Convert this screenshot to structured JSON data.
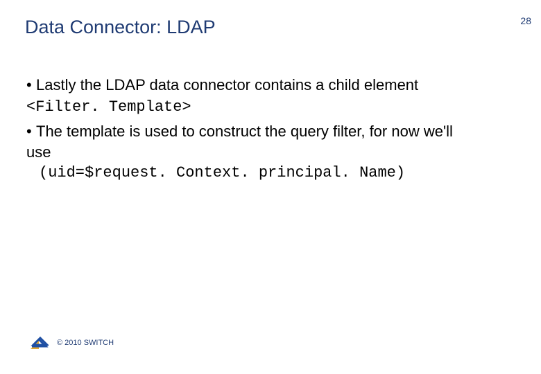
{
  "slide": {
    "title": "Data Connector: LDAP",
    "page_number": "28",
    "bullets": [
      {
        "lead": "Lastly the LDAP data connector contains a child element ",
        "code": "<Filter. Template>"
      },
      {
        "lead": "The template is used to construct the query filter, for now we'll use",
        "code_line": "(uid=$request. Context. principal. Name)"
      }
    ],
    "footer": {
      "copyright": "© 2010 SWITCH"
    },
    "colors": {
      "title": "#1f3b73",
      "logo_blue": "#1f4fa3",
      "logo_yellow": "#e0a838"
    }
  }
}
